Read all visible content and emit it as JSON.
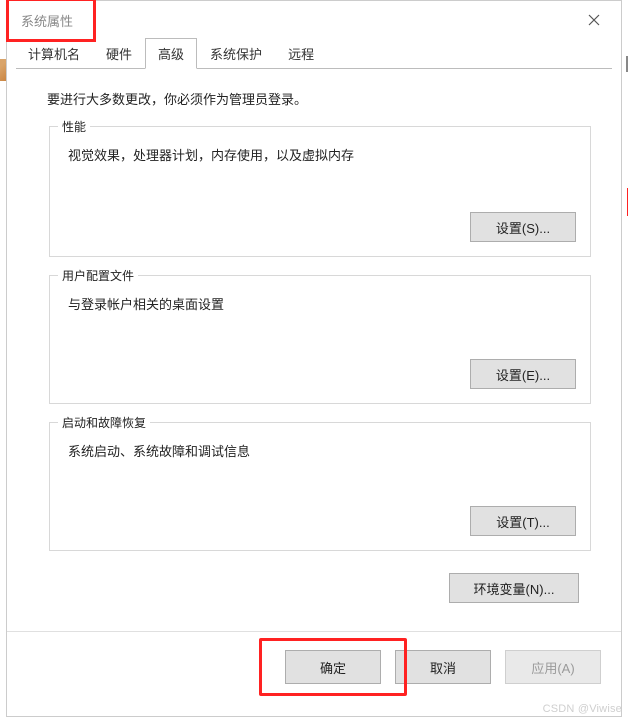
{
  "window": {
    "title": "系统属性"
  },
  "tabs": {
    "computer_name": "计算机名",
    "hardware": "硬件",
    "advanced": "高级",
    "system_protection": "系统保护",
    "remote": "远程"
  },
  "content": {
    "admin_note": "要进行大多数更改，你必须作为管理员登录。",
    "performance": {
      "title": "性能",
      "desc": "视觉效果，处理器计划，内存使用，以及虚拟内存",
      "button": "设置(S)..."
    },
    "user_profiles": {
      "title": "用户配置文件",
      "desc": "与登录帐户相关的桌面设置",
      "button": "设置(E)..."
    },
    "startup": {
      "title": "启动和故障恢复",
      "desc": "系统启动、系统故障和调试信息",
      "button": "设置(T)..."
    },
    "env_vars_button": "环境变量(N)..."
  },
  "footer": {
    "ok": "确定",
    "cancel": "取消",
    "apply": "应用(A)"
  },
  "watermark": "CSDN @Viwise"
}
